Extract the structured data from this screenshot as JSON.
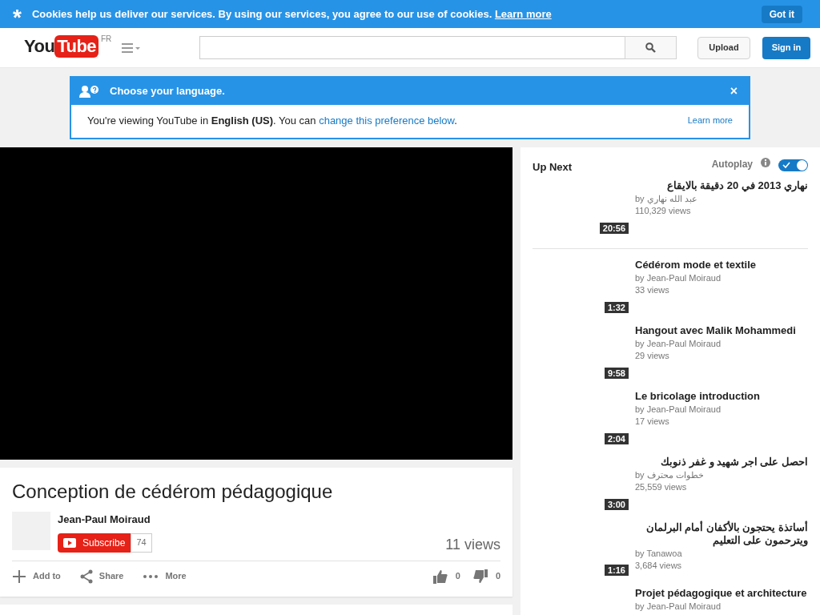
{
  "cookie_bar": {
    "icon": "*",
    "message": "Cookies help us deliver our services. By using our services, you agree to our use of cookies.",
    "link": "Learn more",
    "button": "Got it"
  },
  "header": {
    "logo": "YouTube",
    "country": "FR",
    "upload": "Upload",
    "sign_in": "Sign in"
  },
  "language_notice": {
    "title": "Choose your language.",
    "close": "×",
    "message": "You're viewing YouTube in **English (US)**. You can",
    "link": "change this preference below",
    "end": ".",
    "learn_more": "Learn more"
  },
  "video": {
    "title": "Conception de cédérom pédagogique",
    "channel": "Jean-Paul Moiraud",
    "subscribe": "Subscribe",
    "subscribers": "74",
    "views": "11 views",
    "actions": [
      "Add to",
      "Share",
      "More"
    ],
    "likes": "0",
    "dislikes": "0"
  },
  "up_next": {
    "heading": "Up Next",
    "autoplay": {
      "label": "Autoplay",
      "on": true
    },
    "videos": [
      {
        "title": "نهاري 2013 في 20 دقيقة بالايقاع",
        "rtl": true,
        "by": "by",
        "channel": "عبد الله نهاري",
        "views": "110,329 views",
        "duration": "20:56"
      },
      {
        "title": "Cédérom mode et textile",
        "rtl": false,
        "by": "by",
        "channel": "Jean-Paul Moiraud",
        "views": "33 views",
        "duration": "1:32"
      },
      {
        "title": "Hangout avec Malik Mohammedi",
        "rtl": false,
        "by": "by",
        "channel": "Jean-Paul Moiraud",
        "views": "29 views",
        "duration": "9:58"
      },
      {
        "title": "Le bricolage introduction",
        "rtl": false,
        "by": "by",
        "channel": "Jean-Paul Moiraud",
        "views": "17 views",
        "duration": "2:04"
      },
      {
        "title": "احصل على اجر شهيد و غفر ذنوبك",
        "rtl": true,
        "by": "by",
        "channel": "خطوات محترف",
        "views": "25,559 views",
        "duration": "3:00"
      },
      {
        "title": "أساتذة يحتجون بالأكفان أمام البرلمان ويترحمون على التعليم",
        "rtl": true,
        "by": "by",
        "channel": "Tanawoa",
        "views": "3,684 views",
        "duration": "1:16"
      },
      {
        "title": "Projet pédagogique et architecture",
        "rtl": false,
        "by": "by",
        "channel": "Jean-Paul Moiraud"
      }
    ]
  }
}
